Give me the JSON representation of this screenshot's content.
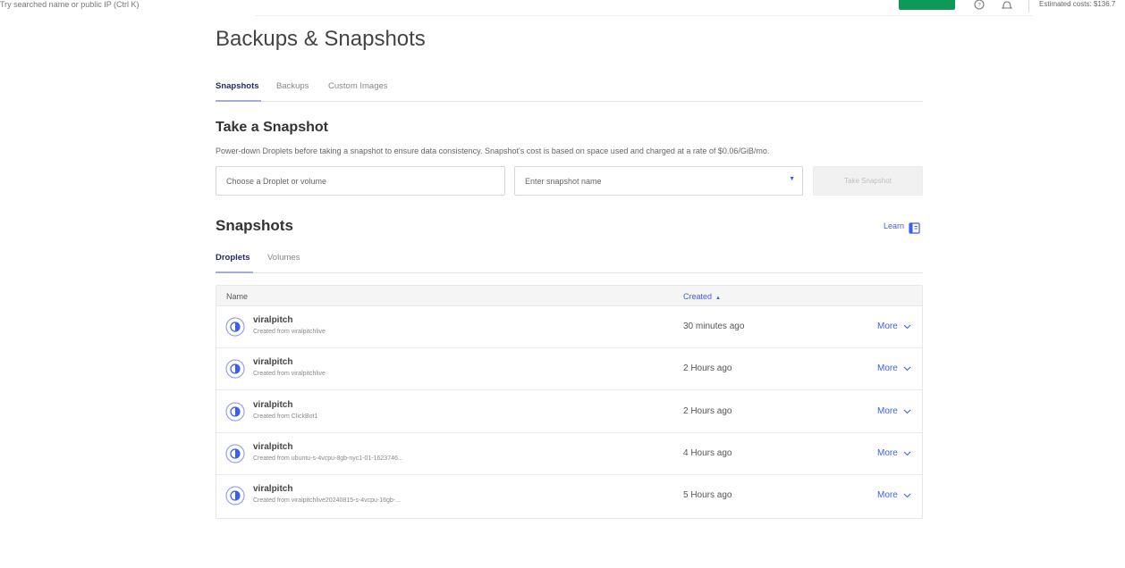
{
  "topbar": {
    "hint": "Try searched name or public IP (Ctrl K)",
    "estimated_costs": "Estimated costs: $136.7",
    "icons": [
      "help-icon",
      "notification-icon"
    ],
    "colors": {
      "create_button": "#0d9a58"
    }
  },
  "page": {
    "title": "Backups & Snapshots",
    "tabs": [
      {
        "label": "Snapshots",
        "active": true
      },
      {
        "label": "Backups",
        "active": false
      },
      {
        "label": "Custom Images",
        "active": false
      }
    ]
  },
  "take_snapshot": {
    "title": "Take a Snapshot",
    "description": "Power-down Droplets before taking a snapshot to ensure data consistency. Snapshot's cost is based on space used and charged at a rate of $0.06/GiB/mo.",
    "resource_placeholder": "Choose a Droplet or volume",
    "name_placeholder": "Enter snapshot name",
    "button_label": "Take Snapshot"
  },
  "snapshots": {
    "title": "Snapshots",
    "learn_label": "Learn",
    "subtabs": [
      {
        "label": "Droplets",
        "active": true
      },
      {
        "label": "Volumes",
        "active": false
      }
    ],
    "columns": {
      "name": "Name",
      "created": "Created"
    },
    "more_label": "More",
    "rows": [
      {
        "name": "viralpitch",
        "source": "Created from viralpitchlive",
        "created": "30 minutes ago"
      },
      {
        "name": "viralpitch",
        "source": "Created from viralpitchlive",
        "created": "2 Hours ago"
      },
      {
        "name": "viralpitch",
        "source": "Created from ClickBot1",
        "created": "2 Hours ago"
      },
      {
        "name": "viralpitch",
        "source": "Created from ubuntu-s-4vcpu-8gb-nyc1-01-1623746...",
        "created": "4 Hours ago"
      },
      {
        "name": "viralpitch",
        "source": "Created from viralpitchlive20240815-s-4vcpu-16gb-...",
        "created": "5 Hours ago"
      }
    ]
  },
  "colors": {
    "accent": "#3c5ef0",
    "active_tab": "#262b6b",
    "tab_underline": "#a6acd8"
  }
}
